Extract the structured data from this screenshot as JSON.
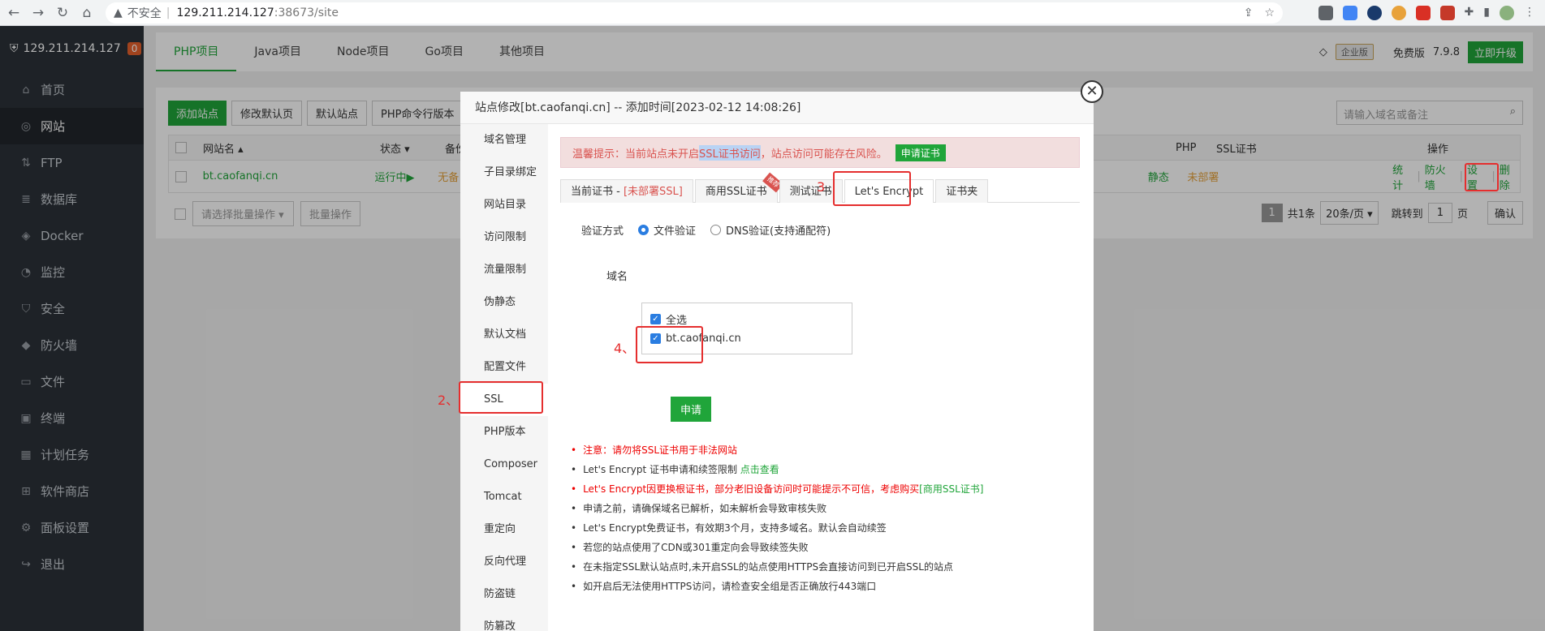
{
  "browser": {
    "security": "不安全",
    "host": "129.211.214.127",
    "path": ":38673/site"
  },
  "sidebar": {
    "server_ip": "129.211.214.127",
    "badge": "0",
    "items": [
      {
        "label": "首页",
        "icon": "home-icon"
      },
      {
        "label": "网站",
        "icon": "globe-icon"
      },
      {
        "label": "FTP",
        "icon": "ftp-icon"
      },
      {
        "label": "数据库",
        "icon": "database-icon"
      },
      {
        "label": "Docker",
        "icon": "docker-icon"
      },
      {
        "label": "监控",
        "icon": "monitor-icon"
      },
      {
        "label": "安全",
        "icon": "shield-icon"
      },
      {
        "label": "防火墙",
        "icon": "firewall-icon"
      },
      {
        "label": "文件",
        "icon": "folder-icon"
      },
      {
        "label": "终端",
        "icon": "terminal-icon"
      },
      {
        "label": "计划任务",
        "icon": "calendar-icon"
      },
      {
        "label": "软件商店",
        "icon": "apps-icon"
      },
      {
        "label": "面板设置",
        "icon": "gear-icon"
      },
      {
        "label": "退出",
        "icon": "logout-icon"
      }
    ]
  },
  "top_tabs": [
    "PHP项目",
    "Java项目",
    "Node项目",
    "Go项目",
    "其他项目"
  ],
  "top_right": {
    "enterprise": "企业版",
    "free": "免费版",
    "version": "7.9.8",
    "upgrade": "立即升级"
  },
  "toolbar": {
    "add_site": "添加站点",
    "modify_default": "修改默认页",
    "default_site": "默认站点",
    "php_cli": "PHP命令行版本",
    "search_placeholder": "请输入域名或备注"
  },
  "table": {
    "headers": {
      "name": "网站名",
      "status": "状态",
      "backup": "备份",
      "php": "PHP",
      "ssl": "SSL证书",
      "ops": "操作"
    },
    "row": {
      "name": "bt.caofanqi.cn",
      "status": "运行中▶",
      "backup": "无备",
      "php": "静态",
      "ssl": "未部署",
      "stats": "统计",
      "firewall": "防火墙",
      "settings": "设置",
      "delete": "删除"
    },
    "batch_placeholder": "请选择批量操作",
    "batch_btn": "批量操作"
  },
  "pager": {
    "page": "1",
    "total": "共1条",
    "per_page": "20条/页",
    "goto": "跳转到",
    "goto_val": "1",
    "page_unit": "页",
    "confirm": "确认"
  },
  "modal": {
    "title": "站点修改[bt.caofanqi.cn] -- 添加时间[2023-02-12 14:08:26]",
    "nav": [
      "域名管理",
      "子目录绑定",
      "网站目录",
      "访问限制",
      "流量限制",
      "伪静态",
      "默认文档",
      "配置文件",
      "SSL",
      "PHP版本",
      "Composer",
      "Tomcat",
      "重定向",
      "反向代理",
      "防盗链",
      "防篡改"
    ],
    "alert_prefix": "温馨提示：当前站点未开启",
    "alert_hl": "SSL证书访问",
    "alert_suffix": "，站点访问可能存在风险。",
    "alert_btn": "申请证书",
    "subtabs": {
      "current_prefix": "当前证书 - ",
      "current_status": "[未部署SSL]",
      "commercial": "商用SSL证书",
      "ribbon": "推荐",
      "test": "测试证书",
      "letsencrypt": "Let's Encrypt",
      "folder": "证书夹"
    },
    "verify_label": "验证方式",
    "verify_file": "文件验证",
    "verify_dns": "DNS验证(支持通配符)",
    "domain_label": "域名",
    "select_all": "全选",
    "domain": "bt.caofanqi.cn",
    "apply": "申请",
    "notes": [
      "注意：请勿将SSL证书用于非法网站",
      "Let's Encrypt 证书申请和续签限制 ",
      "Let's Encrypt因更换根证书，部分老旧设备访问时可能提示不可信，考虑购买",
      "申请之前，请确保域名已解析，如未解析会导致审核失败",
      "Let's Encrypt免费证书，有效期3个月，支持多域名。默认会自动续签",
      "若您的站点使用了CDN或301重定向会导致续签失败",
      "在未指定SSL默认站点时,未开启SSL的站点使用HTTPS会直接访问到已开启SSL的站点",
      "如开启后无法使用HTTPS访问，请检查安全组是否正确放行443端口"
    ],
    "note_link": "点击查看",
    "note_buy": "[商用SSL证书]"
  },
  "annotations": {
    "step2": "2、",
    "step3": "3",
    "step4": "4、"
  },
  "colors": {
    "accent": "#20a53a",
    "annotation": "#e52e2e",
    "sidebar_bg": "#2c3138"
  }
}
